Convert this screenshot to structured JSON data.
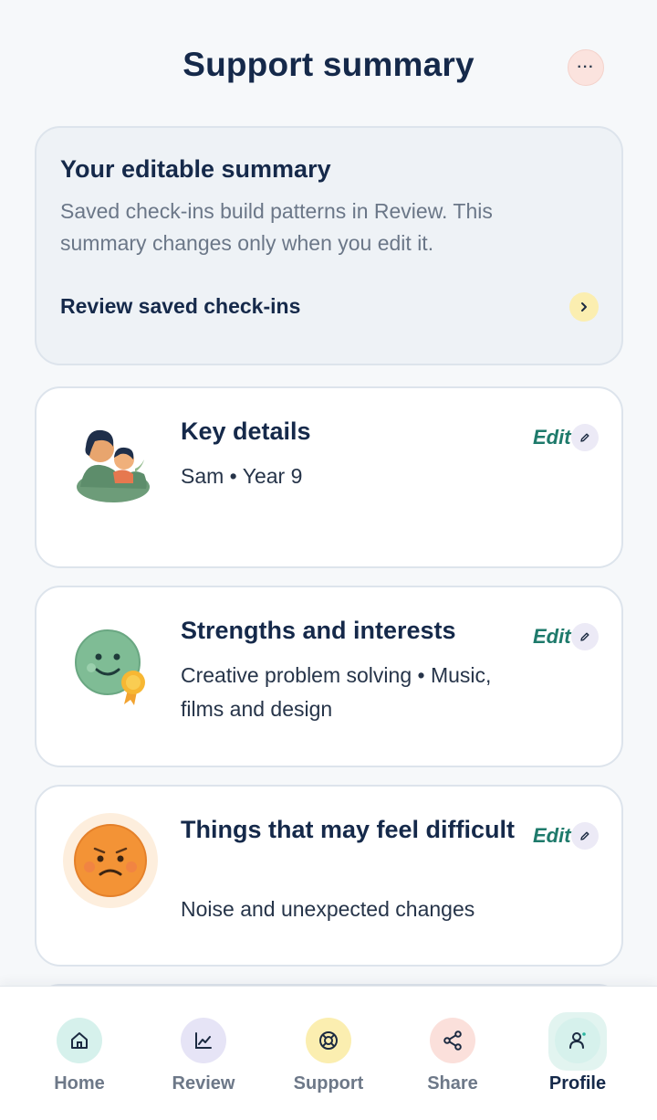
{
  "header": {
    "title": "Support summary",
    "more_icon": "ellipsis-icon",
    "more_label": "···"
  },
  "summary": {
    "title": "Your editable summary",
    "description": "Saved check-ins build patterns in Review. This summary changes only when you edit it.",
    "link_label": "Review saved check-ins"
  },
  "cards": [
    {
      "title": "Key details",
      "body": "Sam • Year 9",
      "edit_label": "Edit",
      "illustration": "parent-and-child-illustration"
    },
    {
      "title": "Strengths and interests",
      "body": "Creative problem solving • Music, films and design",
      "edit_label": "Edit",
      "illustration": "smiling-face-with-award-illustration"
    },
    {
      "title": "Things that may feel difficult",
      "body": "Noise and unexpected changes",
      "edit_label": "Edit",
      "illustration": "worried-face-illustration"
    }
  ],
  "nav": {
    "items": [
      {
        "label": "Home",
        "icon": "home-icon",
        "color": "#d6f1ec"
      },
      {
        "label": "Review",
        "icon": "chart-icon",
        "color": "#e6e4f6"
      },
      {
        "label": "Support",
        "icon": "lifebuoy-icon",
        "color": "#fbeeb0"
      },
      {
        "label": "Share",
        "icon": "share-icon",
        "color": "#fbe0db"
      },
      {
        "label": "Profile",
        "icon": "person-icon",
        "color": "#d6f1ec",
        "active": true
      }
    ]
  },
  "colors": {
    "accent": "#1e7a6b",
    "title": "#15294a",
    "background": "#f6f8fa"
  }
}
